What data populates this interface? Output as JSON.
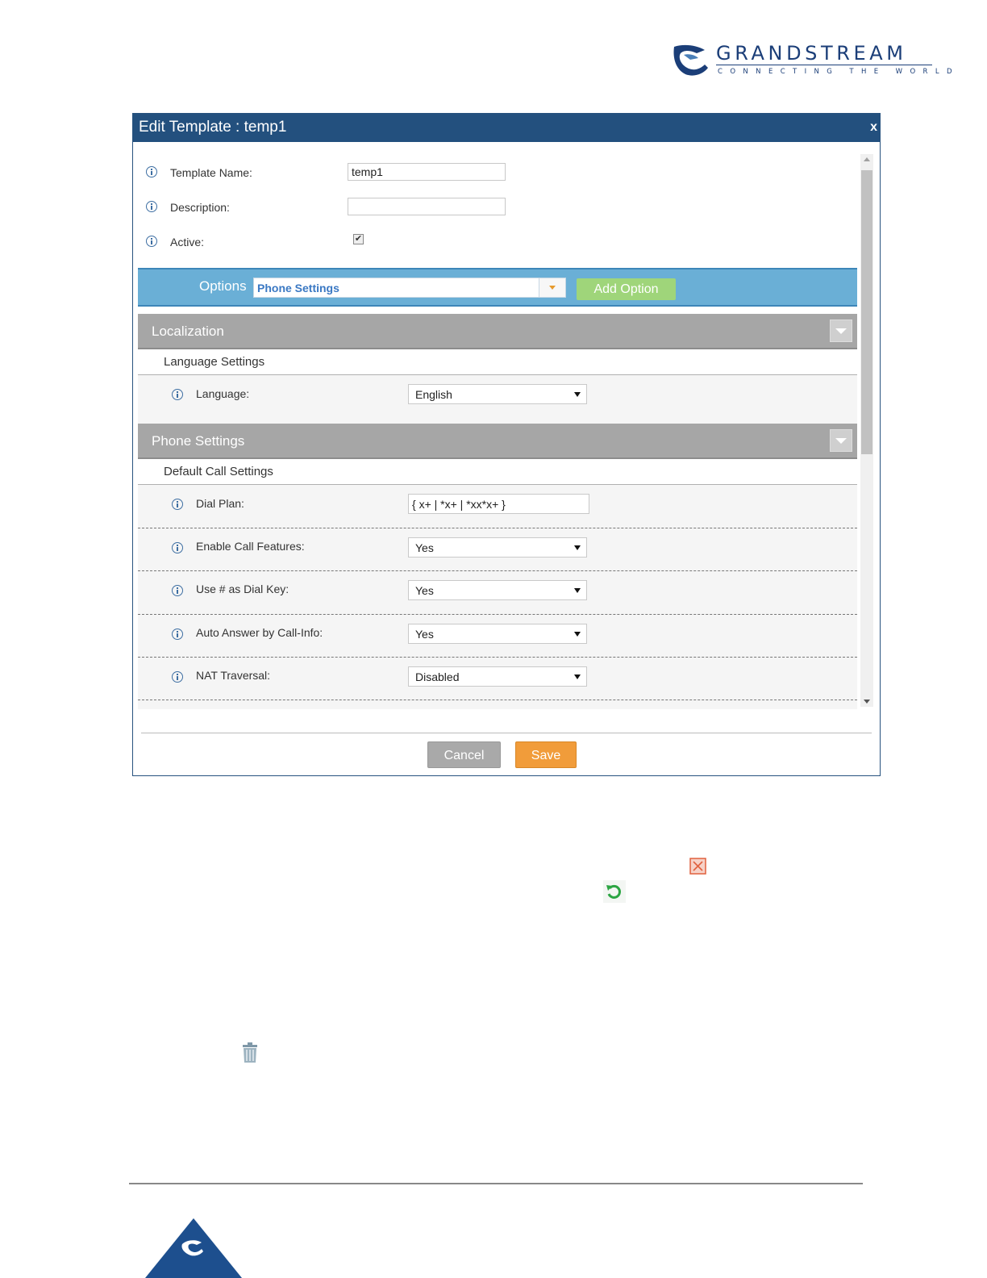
{
  "brand": {
    "name": "GRANDSTREAM",
    "tagline": "CONNECTING THE WORLD",
    "color": "#1b3e78"
  },
  "dialog": {
    "title": "Edit Template : temp1",
    "close_label": "x",
    "fields": {
      "template_name_label": "Template Name:",
      "template_name_value": "temp1",
      "description_label": "Description:",
      "description_value": "",
      "active_label": "Active:",
      "active_checked": true
    },
    "options": {
      "label": "Options",
      "selected": "Phone Settings",
      "add_button": "Add Option"
    },
    "sections": [
      {
        "title": "Localization",
        "subsection": "Language Settings",
        "rows": [
          {
            "label": "Language:",
            "type": "select",
            "value": "English"
          }
        ]
      },
      {
        "title": "Phone Settings",
        "subsection": "Default Call Settings",
        "rows": [
          {
            "label": "Dial Plan:",
            "type": "text",
            "value": "{ x+ | *x+ | *xx*x+ }"
          },
          {
            "label": "Enable Call Features:",
            "type": "select",
            "value": "Yes"
          },
          {
            "label": "Use # as Dial Key:",
            "type": "select",
            "value": "Yes"
          },
          {
            "label": "Auto Answer by Call-Info:",
            "type": "select",
            "value": "Yes"
          },
          {
            "label": "NAT Traversal:",
            "type": "select",
            "value": "Disabled"
          }
        ]
      }
    ],
    "cancel_label": "Cancel",
    "save_label": "Save"
  },
  "icons": {
    "delete_option": "close-box-icon",
    "reset": "reset-icon",
    "trash": "trash-icon"
  },
  "colors": {
    "title_bar": "#23507e",
    "options_bar": "#6aafd6",
    "section_header": "#a6a6a6",
    "save_button": "#f19c3a",
    "add_option_button": "#9fd57a"
  }
}
